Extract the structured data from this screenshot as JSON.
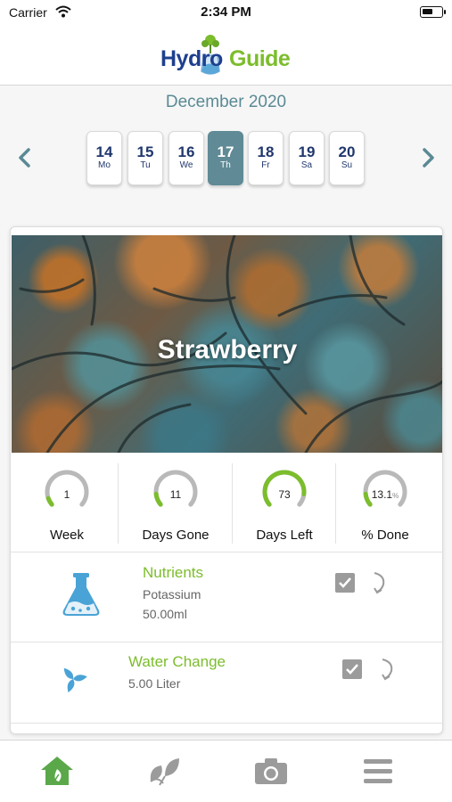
{
  "status_bar": {
    "carrier": "Carrier",
    "time": "2:34 PM"
  },
  "app": {
    "logo_part1": "Hydro",
    "logo_part2": "Guide",
    "brand_blue": "#1f3f8f",
    "brand_green": "#7cbd2c"
  },
  "calendar": {
    "month": "December 2020",
    "days": [
      {
        "num": "14",
        "name": "Mo"
      },
      {
        "num": "15",
        "name": "Tu"
      },
      {
        "num": "16",
        "name": "We"
      },
      {
        "num": "17",
        "name": "Th"
      },
      {
        "num": "18",
        "name": "Fr"
      },
      {
        "num": "19",
        "name": "Sa"
      },
      {
        "num": "20",
        "name": "Su"
      }
    ],
    "selected": "17",
    "accent": "#5f8a96"
  },
  "plant": {
    "name": "Strawberry"
  },
  "stats": [
    {
      "value": "1",
      "label": "Week",
      "fraction": 0.08
    },
    {
      "value": "11",
      "label": "Days Gone",
      "fraction": 0.13
    },
    {
      "value": "73",
      "label": "Days Left",
      "fraction": 0.87
    },
    {
      "value": "13.1",
      "unit": "%",
      "label": "% Done",
      "fraction": 0.13
    }
  ],
  "tasks": [
    {
      "title": "Nutrients",
      "detail1": "Potassium",
      "detail2": "50.00ml",
      "icon": "flask-icon",
      "checked": true
    },
    {
      "title": "Water Change",
      "detail1": "5.00  Liter",
      "icon": "water-drops-icon",
      "checked": true
    }
  ],
  "tabbar": [
    {
      "icon": "home-icon",
      "active": true
    },
    {
      "icon": "leaves-icon",
      "active": false
    },
    {
      "icon": "camera-icon",
      "active": false
    },
    {
      "icon": "menu-icon",
      "active": false
    }
  ]
}
